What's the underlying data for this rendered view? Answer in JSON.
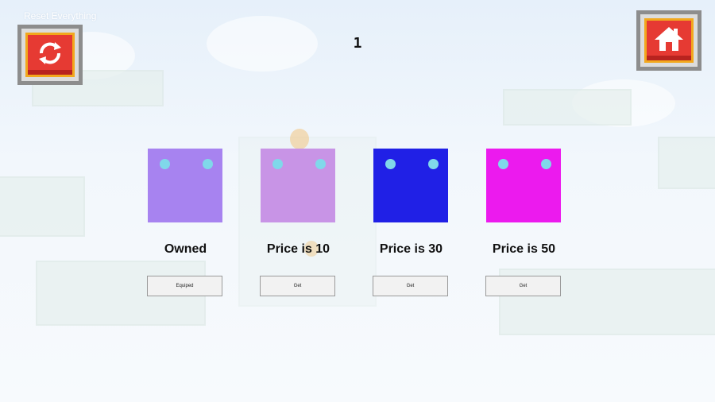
{
  "header": {
    "reset_label": "Reset Everything",
    "score": "1",
    "reset_icon": "refresh-icon",
    "home_icon": "home-icon"
  },
  "colors": {
    "button_red": "#e63a33",
    "button_gold": "#f2a81d",
    "eye": "#80d8ea"
  },
  "skins": [
    {
      "color": "#a783f0",
      "price_label": "Owned",
      "button_label": "Equiped"
    },
    {
      "color": "#c894e6",
      "price_label": "Price is 10",
      "button_label": "Get"
    },
    {
      "color": "#2020e6",
      "price_label": "Price is 30",
      "button_label": "Get"
    },
    {
      "color": "#ec1aee",
      "price_label": "Price is 50",
      "button_label": "Get"
    }
  ]
}
